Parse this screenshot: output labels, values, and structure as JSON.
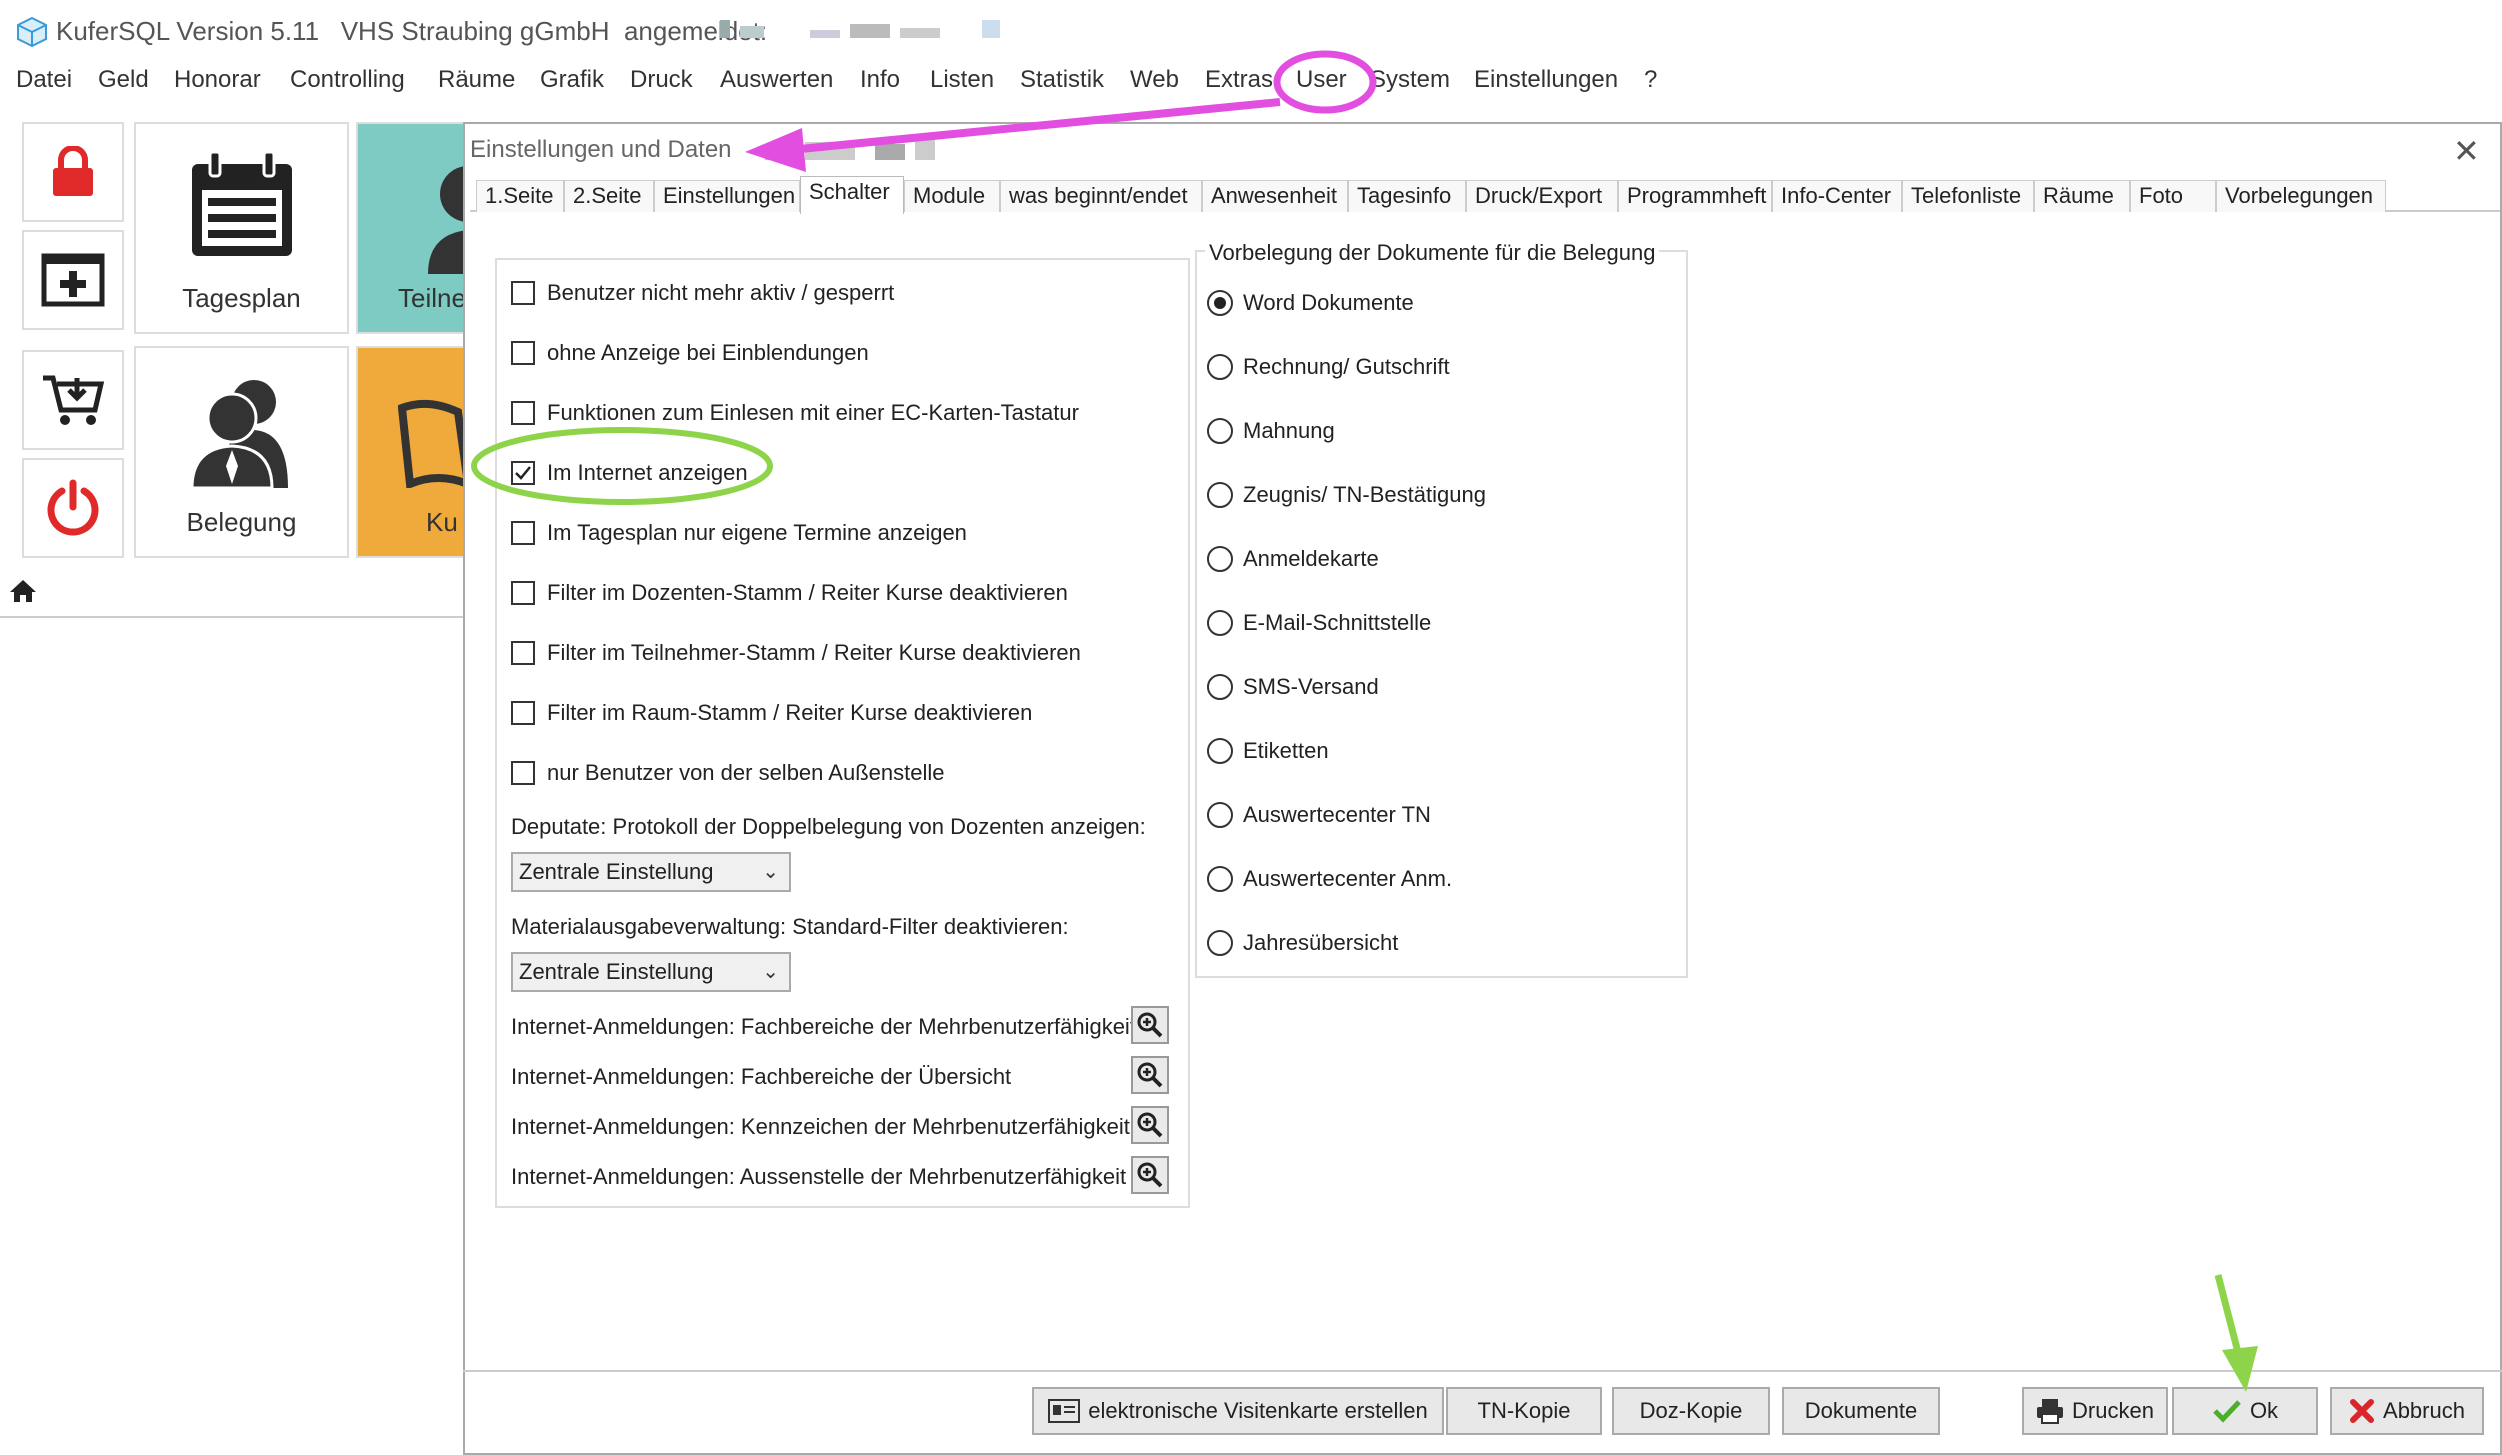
{
  "window": {
    "app_name": "KuferSQL Version 5.11",
    "organization": "VHS Straubing gGmbH",
    "logged_in_label": "angemeldet:"
  },
  "menu": [
    "Datei",
    "Geld",
    "Honorar",
    "Controlling",
    "Räume",
    "Grafik",
    "Druck",
    "Auswerten",
    "Info",
    "Listen",
    "Statistik",
    "Web",
    "Extras",
    "User",
    "System",
    "Einstellungen",
    "?"
  ],
  "tiles": {
    "tagesplan": "Tagesplan",
    "teilnehmer": "Teilne",
    "belegung": "Belegung",
    "kurse": "Ku"
  },
  "dialog": {
    "title": "Einstellungen und Daten",
    "tabs": [
      "1.Seite",
      "2.Seite",
      "Einstellungen",
      "Schalter",
      "Module",
      "was beginnt/endet",
      "Anwesenheit",
      "Tagesinfo",
      "Druck/Export",
      "Programmheft",
      "Info-Center",
      "Telefonliste",
      "Räume",
      "Foto",
      "Vorbelegungen"
    ],
    "active_tab": "Schalter",
    "checkboxes": [
      {
        "label": "Benutzer nicht mehr aktiv / gesperrt",
        "checked": false
      },
      {
        "label": "ohne Anzeige bei Einblendungen",
        "checked": false
      },
      {
        "label": "Funktionen zum Einlesen mit einer EC-Karten-Tastatur",
        "checked": false
      },
      {
        "label": "Im Internet anzeigen",
        "checked": true
      },
      {
        "label": "Im Tagesplan nur eigene Termine anzeigen",
        "checked": false
      },
      {
        "label": "Filter im Dozenten-Stamm / Reiter Kurse deaktivieren",
        "checked": false
      },
      {
        "label": "Filter im Teilnehmer-Stamm / Reiter Kurse deaktivieren",
        "checked": false
      },
      {
        "label": "Filter im Raum-Stamm / Reiter Kurse deaktivieren",
        "checked": false
      },
      {
        "label": "nur Benutzer von der selben Außenstelle",
        "checked": false
      }
    ],
    "deputate_label": "Deputate: Protokoll der Doppelbelegung von Dozenten anzeigen:",
    "deputate_value": "Zentrale Einstellung",
    "material_label": "Materialausgabeverwaltung: Standard-Filter deaktivieren:",
    "material_value": "Zentrale Einstellung",
    "internet_rows": [
      "Internet-Anmeldungen: Fachbereiche der Mehrbenutzerfähigkeit",
      "Internet-Anmeldungen: Fachbereiche der Übersicht",
      "Internet-Anmeldungen: Kennzeichen der Mehrbenutzerfähigkeit",
      "Internet-Anmeldungen: Aussenstelle der Mehrbenutzerfähigkeit"
    ],
    "vorbelegung_title": "Vorbelegung der Dokumente für die Belegung",
    "radios": [
      {
        "label": "Word Dokumente",
        "selected": true
      },
      {
        "label": "Rechnung/ Gutschrift",
        "selected": false
      },
      {
        "label": "Mahnung",
        "selected": false
      },
      {
        "label": "Zeugnis/ TN-Bestätigung",
        "selected": false
      },
      {
        "label": "Anmeldekarte",
        "selected": false
      },
      {
        "label": "E-Mail-Schnittstelle",
        "selected": false
      },
      {
        "label": "SMS-Versand",
        "selected": false
      },
      {
        "label": "Etiketten",
        "selected": false
      },
      {
        "label": "Auswertecenter TN",
        "selected": false
      },
      {
        "label": "Auswertecenter Anm.",
        "selected": false
      },
      {
        "label": "Jahresübersicht",
        "selected": false
      }
    ],
    "buttons": {
      "visitenkarte": "elektronische Visitenkarte erstellen",
      "tn_kopie": "TN-Kopie",
      "doz_kopie": "Doz-Kopie",
      "dokumente": "Dokumente",
      "drucken": "Drucken",
      "ok": "Ok",
      "abbruch": "Abbruch"
    }
  },
  "colors": {
    "teal_tile": "#7ecbc3",
    "orange_tile": "#f0a93b",
    "red_icon": "#e02a2a",
    "magenta_annotation": "#e24ee0",
    "green_annotation": "#8ed44a",
    "ok_check": "#4caf2a",
    "cancel_x": "#d9262b"
  }
}
